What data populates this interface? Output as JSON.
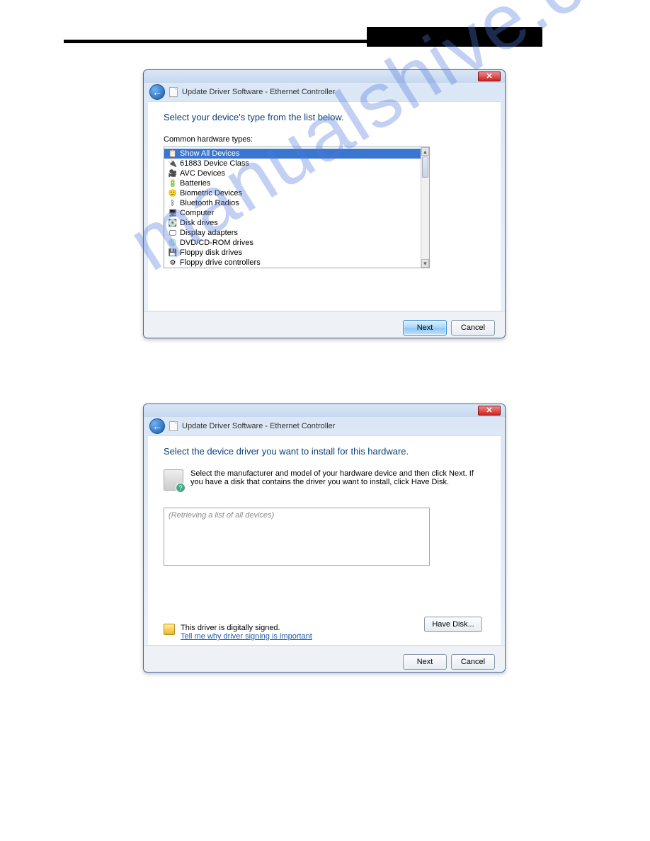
{
  "watermark": "manualshive.com",
  "dialog1": {
    "title": "Update Driver Software -  Ethernet Controller",
    "heading": "Select your device's type from the list below.",
    "list_label": "Common hardware types:",
    "items": [
      {
        "label": "Show All Devices",
        "selected": true,
        "icon": "📋"
      },
      {
        "label": "61883 Device Class",
        "icon": "🔌"
      },
      {
        "label": "AVC Devices",
        "icon": "🎥"
      },
      {
        "label": "Batteries",
        "icon": "🔋"
      },
      {
        "label": "Biometric Devices",
        "icon": "🙂"
      },
      {
        "label": "Bluetooth Radios",
        "icon": "ᛒ"
      },
      {
        "label": "Computer",
        "icon": "🖥"
      },
      {
        "label": "Disk drives",
        "icon": "💽"
      },
      {
        "label": "Display adapters",
        "icon": "🖵"
      },
      {
        "label": "DVD/CD-ROM drives",
        "icon": "💿"
      },
      {
        "label": "Floppy disk drives",
        "icon": "💾"
      },
      {
        "label": "Floppy drive controllers",
        "icon": "⚙"
      }
    ],
    "next": "Next",
    "cancel": "Cancel"
  },
  "dialog2": {
    "title": "Update Driver Software -  Ethernet Controller",
    "heading": "Select the device driver you want to install for this hardware.",
    "info": "Select the manufacturer and model of your hardware device and then click Next. If you have a disk that contains the driver you want to install, click Have Disk.",
    "retrieving": "(Retrieving a list of all devices)",
    "signed": "This driver is digitally signed.",
    "signing_link": "Tell me why driver signing is important",
    "have_disk": "Have Disk...",
    "next": "Next",
    "cancel": "Cancel"
  }
}
